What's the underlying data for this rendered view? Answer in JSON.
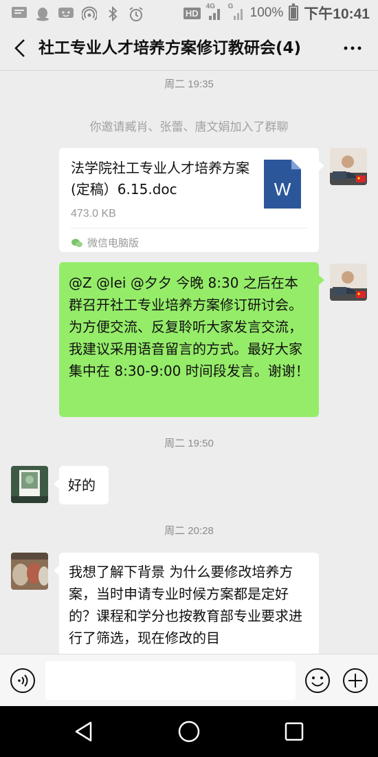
{
  "status_bar": {
    "icons_left": [
      "message-icon",
      "qq-icon",
      "chat-app-icon",
      "hotspot-icon",
      "bluetooth-icon",
      "alarm-icon"
    ],
    "hd": "HD",
    "net_4g": "4G",
    "net_g": "G",
    "battery": "100%",
    "time": "下午10:41"
  },
  "header": {
    "title": "社工专业人才培养方案修订教研会(4)"
  },
  "messages": {
    "t1": "周二 19:35",
    "system": "你邀请臧肖、张蕾、唐文娟加入了群聊",
    "file": {
      "name": "法学院社工专业人才培养方案(定稿）6.15.doc",
      "size": "473.0 KB",
      "icon_letter": "W",
      "source": "微信电脑版"
    },
    "green_text": "@Z @lei @夕夕 今晚 8:30 之后在本群召开社工专业培养方案修订研讨会。为方便交流、反复聆听大家发言交流，我建议采用语音留言的方式。最好大家集中在 8:30-9:00 时间段发言。谢谢！",
    "t2": "周二 19:50",
    "reply1": "好的",
    "t3": "周二 20:28",
    "reply2": "我想了解下背景 为什么要修改培养方案，当时申请专业时候方案都是定好的？课程和学分也按教育部专业要求进行了筛选，现在修改的目"
  },
  "colors": {
    "chat_bg": "#ededed",
    "green_bubble": "#95ec69",
    "white_bubble": "#ffffff",
    "word_blue": "#2b579a"
  }
}
